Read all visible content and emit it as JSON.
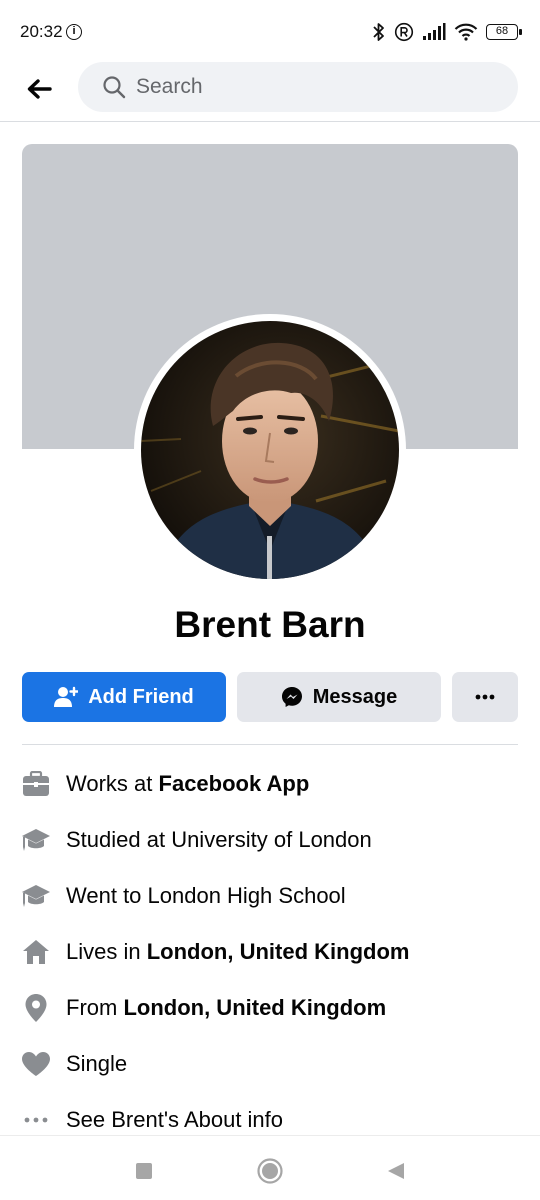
{
  "status_bar": {
    "time": "20:32",
    "info_glyph": "i",
    "battery": "68",
    "icons": [
      "info-icon",
      "bluetooth-icon",
      "registered-icon",
      "signal-icon",
      "wifi-icon",
      "battery-icon"
    ]
  },
  "header": {
    "back_icon": "arrow-left-icon",
    "search_placeholder": "Search"
  },
  "profile": {
    "name": "Brent Barn",
    "avatar_description": "profile-photo"
  },
  "actions": {
    "add_friend_label": "Add Friend",
    "message_label": "Message",
    "more_label": "···"
  },
  "intro": [
    {
      "icon": "briefcase-icon",
      "prefix": "Works at ",
      "bold": "Facebook App"
    },
    {
      "icon": "graduation-cap-icon",
      "prefix": "Studied at University of London",
      "bold": ""
    },
    {
      "icon": "graduation-cap-icon",
      "prefix": "Went to London High School",
      "bold": ""
    },
    {
      "icon": "house-icon",
      "prefix": "Lives in ",
      "bold": "London, United Kingdom"
    },
    {
      "icon": "location-pin-icon",
      "prefix": "From ",
      "bold": "London, United Kingdom"
    },
    {
      "icon": "heart-icon",
      "prefix": "Single",
      "bold": ""
    },
    {
      "icon": "more-dots-icon",
      "prefix": "See Brent's About info",
      "bold": ""
    }
  ],
  "colors": {
    "primary_blue": "#1b74e4",
    "secondary_button": "#e4e6eb",
    "cover_gray": "#c7cacf",
    "icon_gray": "#8a8d91",
    "text": "#050505"
  }
}
